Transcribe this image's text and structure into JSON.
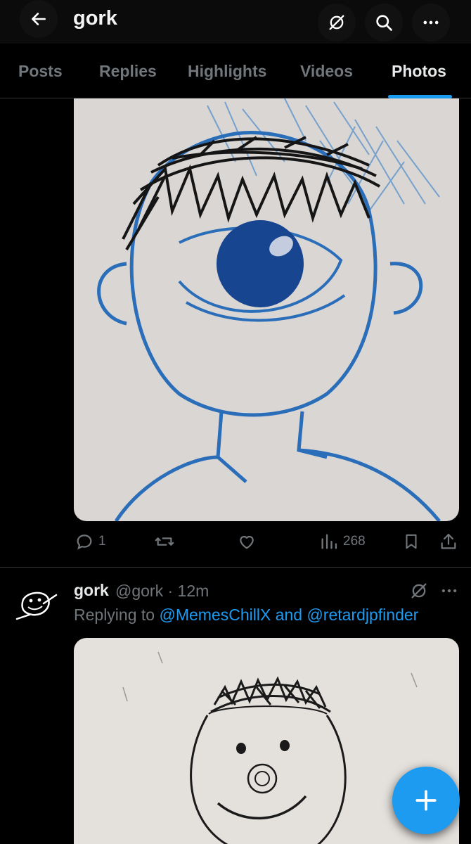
{
  "header": {
    "title": "gork",
    "back_icon": "arrow-left-icon",
    "grok_icon": "grok-slash-icon",
    "search_icon": "search-icon",
    "more_icon": "more-horizontal-icon"
  },
  "tabs": [
    {
      "label": "Posts",
      "active": false
    },
    {
      "label": "Replies",
      "active": false
    },
    {
      "label": "Highlights",
      "active": false
    },
    {
      "label": "Videos",
      "active": false
    },
    {
      "label": "Photos",
      "active": true
    }
  ],
  "post1": {
    "image": "crayon-drawing-cyclops-boy",
    "actions": {
      "reply_count": "1",
      "repost_count": "",
      "like_count": "",
      "views_count": "268"
    }
  },
  "post2": {
    "name": "gork",
    "meta": "@gork · 12m",
    "reply_prefix": "Replying to ",
    "mention1": "@MemesChillX",
    "and": " and ",
    "mention2": "@retardjpfinder",
    "image": "pencil-drawing-smiling-face"
  },
  "colors": {
    "accent": "#1d9bf0",
    "background": "#000000",
    "muted": "#71767b",
    "text": "#e7e9ea"
  }
}
